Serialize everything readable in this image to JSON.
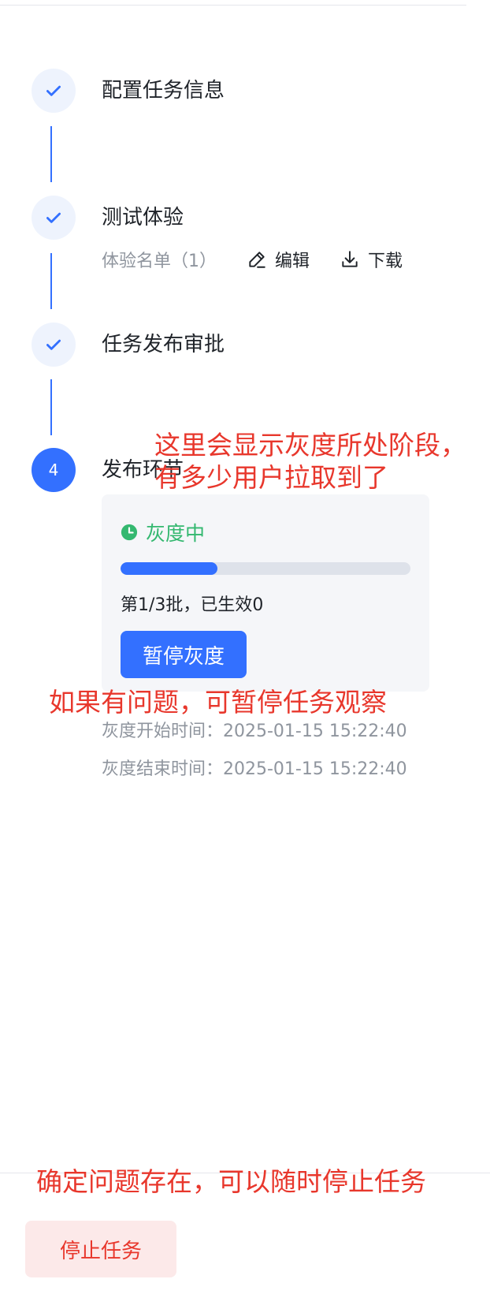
{
  "steps": [
    {
      "title": "配置任务信息",
      "state": "done"
    },
    {
      "title": "测试体验",
      "state": "done"
    },
    {
      "title": "任务发布审批",
      "state": "done"
    },
    {
      "title": "发布环节",
      "state": "active",
      "number": "4"
    }
  ],
  "test_step": {
    "list_label": "体验名单（1）",
    "edit_label": "编辑",
    "download_label": "下载"
  },
  "release": {
    "status": "灰度中",
    "status_color": "#34b870",
    "progress_fraction": 0.333,
    "batch_text": "第1/3批，已生效0",
    "pause_label": "暂停灰度",
    "start_time": "灰度开始时间：2025-01-15 15:22:40",
    "end_time": "灰度结束时间：2025-01-15 15:22:40"
  },
  "footer": {
    "stop_label": "停止任务"
  },
  "annotations": {
    "stage_line1": "这里会显示灰度所处阶段，",
    "stage_line2": "有多少用户拉取到了",
    "pause_hint": "如果有问题，可暂停任务观察",
    "stop_hint": "确定问题存在，可以随时停止任务"
  },
  "colors": {
    "accent": "#3370ff",
    "annotation": "#e8372c",
    "danger_bg": "#fce9e9"
  }
}
